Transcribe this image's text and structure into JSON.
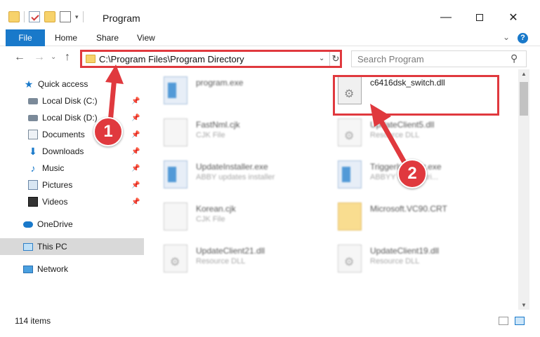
{
  "window": {
    "title": "Program",
    "minimize": "—",
    "close": "✕"
  },
  "ribbon": {
    "tabs": [
      "File",
      "Home",
      "Share",
      "View"
    ],
    "help": "?"
  },
  "address": {
    "path": "C:\\Program Files\\Program Directory",
    "search_placeholder": "Search Program"
  },
  "sidebar": {
    "items": [
      {
        "label": "Quick access",
        "icon": "star-icon"
      },
      {
        "label": "Local Disk (C:)",
        "icon": "drive-icon",
        "pinned": true
      },
      {
        "label": "Local Disk (D:)",
        "icon": "drive-icon",
        "pinned": true
      },
      {
        "label": "Documents",
        "icon": "documents-icon",
        "pinned": true
      },
      {
        "label": "Downloads",
        "icon": "download-icon",
        "pinned": true
      },
      {
        "label": "Music",
        "icon": "music-icon",
        "pinned": true
      },
      {
        "label": "Pictures",
        "icon": "pictures-icon",
        "pinned": true
      },
      {
        "label": "Videos",
        "icon": "videos-icon",
        "pinned": true
      },
      {
        "label": "OneDrive",
        "icon": "cloud-icon"
      },
      {
        "label": "This PC",
        "icon": "pc-icon",
        "selected": true
      },
      {
        "label": "Network",
        "icon": "network-icon"
      }
    ]
  },
  "files": [
    {
      "name": "program.exe",
      "desc": "",
      "kind": "exe"
    },
    {
      "name": "c6416dsk_switch.dll",
      "desc": "",
      "kind": "gear",
      "highlighted": true
    },
    {
      "name": "FastNml.cjk",
      "desc": "CJK File",
      "kind": "doc"
    },
    {
      "name": "UpdateClient5.dll",
      "desc": "Resource DLL",
      "kind": "gear"
    },
    {
      "name": "UpdateInstaller.exe",
      "desc": "ABBY updates installer",
      "kind": "exe"
    },
    {
      "name": "TriggerInstaller.exe",
      "desc": "ABBYY Reader tri...",
      "kind": "exe"
    },
    {
      "name": "Korean.cjk",
      "desc": "CJK File",
      "kind": "doc"
    },
    {
      "name": "Microsoft.VC90.CRT",
      "desc": "",
      "kind": "folder"
    },
    {
      "name": "UpdateClient21.dll",
      "desc": "Resource DLL",
      "kind": "gear"
    },
    {
      "name": "UpdateClient19.dll",
      "desc": "Resource DLL",
      "kind": "gear"
    }
  ],
  "status": {
    "item_count": "114 items"
  },
  "annotations": {
    "step1": "1",
    "step2": "2",
    "color": "#e0393e"
  }
}
